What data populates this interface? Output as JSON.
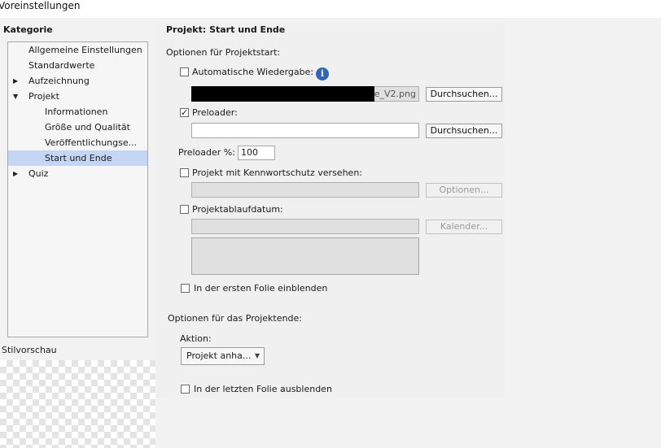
{
  "window": {
    "title": "Voreinstellungen"
  },
  "sidebar": {
    "header": "Kategorie",
    "items": [
      {
        "label": "Allgemeine Einstellungen"
      },
      {
        "label": "Standardwerte"
      },
      {
        "label": "Aufzeichnung",
        "expander": "▶"
      },
      {
        "label": "Projekt",
        "expander": "▼"
      },
      {
        "label": "Informationen"
      },
      {
        "label": "Größe und Qualität"
      },
      {
        "label": "Veröffentlichungse..."
      },
      {
        "label": "Start und Ende",
        "selected": true
      },
      {
        "label": "Quiz",
        "expander": "▶"
      }
    ],
    "preview_label": "Stilvorschau"
  },
  "main": {
    "title": "Projekt: Start und Ende",
    "start_section": "Optionen für Projektstart:",
    "autoplay": {
      "label": "Automatische Wiedergabe:",
      "checked": false,
      "file_value": "e_V2.png",
      "browse": "Durchsuchen..."
    },
    "info_icon": "i",
    "preloader": {
      "label": "Preloader:",
      "checkmark": "✓",
      "value": "",
      "browse": "Durchsuchen..."
    },
    "preloader_percent": {
      "label": "Preloader %:",
      "value": "100"
    },
    "password": {
      "label": "Projekt mit Kennwortschutz versehen:",
      "button": "Optionen..."
    },
    "expiry": {
      "label": "Projektablaufdatum:",
      "button": "Kalender..."
    },
    "first_slide": {
      "label": "In der ersten Folie einblenden"
    },
    "end_section": "Optionen für das Projektende:",
    "action": {
      "label": "Aktion:",
      "value": "Projekt anha...",
      "arrow": "▼"
    },
    "last_slide": {
      "label": "In der letzten Folie ausblenden"
    }
  },
  "colors": {
    "selection": "#c4d6f3",
    "info_icon": "#2f66b3"
  }
}
